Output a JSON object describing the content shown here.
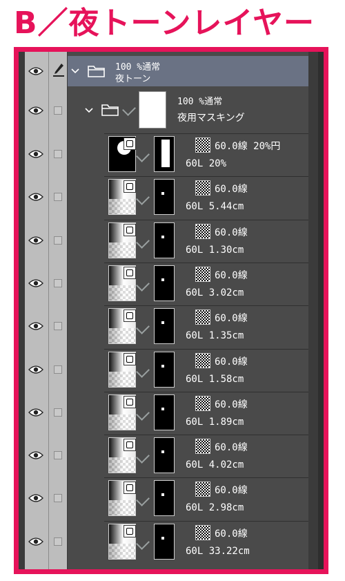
{
  "title": "B／夜トーンレイヤー",
  "folder": {
    "opacity_blend": "100 %通常",
    "name": "夜トーン"
  },
  "mask_layer": {
    "opacity_blend": "100 %通常",
    "name": "夜用マスキング"
  },
  "tone_layers": [
    {
      "line": "60.0線 20%円",
      "sub": "60L 20%"
    },
    {
      "line": "60.0線",
      "sub": "60L 5.44cm"
    },
    {
      "line": "60.0線",
      "sub": "60L 1.30cm"
    },
    {
      "line": "60.0線",
      "sub": "60L 3.02cm"
    },
    {
      "line": "60.0線",
      "sub": "60L 1.35cm"
    },
    {
      "line": "60.0線",
      "sub": "60L 1.58cm"
    },
    {
      "line": "60.0線",
      "sub": "60L 1.89cm"
    },
    {
      "line": "60.0線",
      "sub": "60L 4.02cm"
    },
    {
      "line": "60.0線",
      "sub": "60L 2.98cm"
    },
    {
      "line": "60.0線",
      "sub": "60L 33.22cm"
    }
  ],
  "colors": {
    "accent": "#e6135a",
    "panel": "#4a4a4a",
    "selected_row": "#6a7284"
  },
  "icons": {
    "visibility": "eye-icon",
    "lock": "pen-icon",
    "folder": "folder-icon",
    "expand": "chevron-down-icon"
  }
}
